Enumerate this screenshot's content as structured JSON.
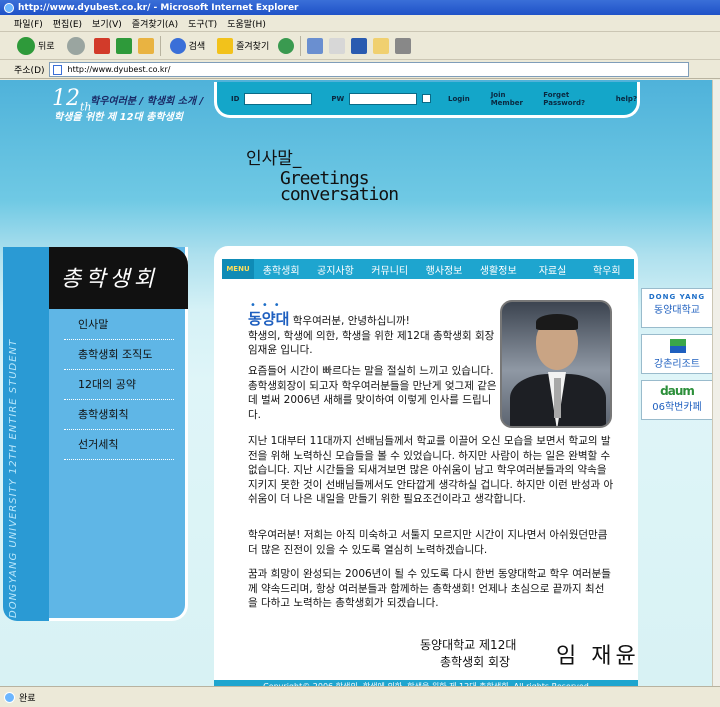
{
  "window": {
    "title": "http://www.dyubest.co.kr/ - Microsoft Internet Explorer"
  },
  "menubar": [
    "파일(F)",
    "편집(E)",
    "보기(V)",
    "즐겨찾기(A)",
    "도구(T)",
    "도움말(H)"
  ],
  "toolbar": {
    "back": "뒤로",
    "search": "검색",
    "favorites": "즐겨찾기"
  },
  "address": {
    "label": "주소(D)",
    "url": "http://www.dyubest.co.kr/"
  },
  "header": {
    "number": "12",
    "suffix": "th",
    "slogan1": "학우여러분 / 학생회 소개 /",
    "slogan2": "학생을 위한 제 12대 총학생회"
  },
  "login": {
    "id_label": "ID",
    "pw_label": "PW",
    "login": "Login",
    "join": "Join Member",
    "forgot": "Forget Password?",
    "help": "help?"
  },
  "greeting": {
    "ko": "인사말_",
    "en1": "Greetings",
    "en2": "conversation"
  },
  "sidebar": {
    "title": "총학생회",
    "vertical": "DONGYANG UNIVERSITY 12TH ENTIRE STUDENT",
    "items": [
      "인사말",
      "총학생회 조직도",
      "12대의 공약",
      "총학생회칙",
      "선거세칙"
    ]
  },
  "nav": {
    "menu": "MENU",
    "items": [
      "총학생회",
      "공지사항",
      "커뮤니티",
      "행사정보",
      "생활정보",
      "자료실",
      "학우회"
    ]
  },
  "content": {
    "dots": "•••",
    "brand": "동양대",
    "p1_first": "학우여러분, 안녕하십니까!",
    "p1_rest": "학생의, 학생에 의한, 학생을 위한 제12대 총학생회 회장 임재윤 입니다.",
    "p2": "요즘들어 시간이 빠르다는 말을 절실히 느끼고 있습니다. 총학생회장이 되고자 학우여러분들을 만난게 엊그제 같은데 벌써 2006년 새해를 맞이하여 이렇게 인사를 드립니다.",
    "p3": "지난 1대부터 11대까지 선배님들께서 학교를 이끌어 오신 모습을 보면서 학교의 발전을 위해 노력하신 모습들을 볼 수 있었습니다. 하지만 사람이 하는 일은 완벽할 수 없습니다. 지난 시간들을 되새겨보면 많은 아쉬움이 남고 학우여러분들과의 약속을 지키지 못한 것이 선배님들께서도 안타깝게 생각하실 겁니다. 하지만 이런 반성과 아쉬움이 더 나은 내일을 만들기 위한 필요조건이라고 생각합니다.",
    "p4": "학우여러분! 저희는 아직 미숙하고 서툴지 모르지만 시간이 지나면서 아쉬웠던만큼 더 많은 진전이 있을 수 있도록 열심히 노력하겠습니다.",
    "p5": "꿈과 희망이 완성되는 2006년이 될 수 있도록 다시 한번 동양대학교 학우 여러분들께 약속드리며, 항상 여러분들과 함께하는 총학생회! 언제나 초심으로 끝까지 최선을 다하고 노력하는 총학생회가 되겠습니다.",
    "sign_org1": "동양대학교 제12대",
    "sign_org2": "총학생회 회장",
    "sign_name": "임 재윤",
    "copyright": "Copyright© 2006 학생의, 학생에 의한, 학생을 위한 제 12대 총학생회. All rights Reserved"
  },
  "banners": {
    "b1_top": "DONG YANG",
    "b1_bottom": "동양대학교",
    "b2": "강촌리조트",
    "b3_top": "daum",
    "b3_bottom": "06학번카페"
  },
  "status": {
    "text": "완료"
  }
}
